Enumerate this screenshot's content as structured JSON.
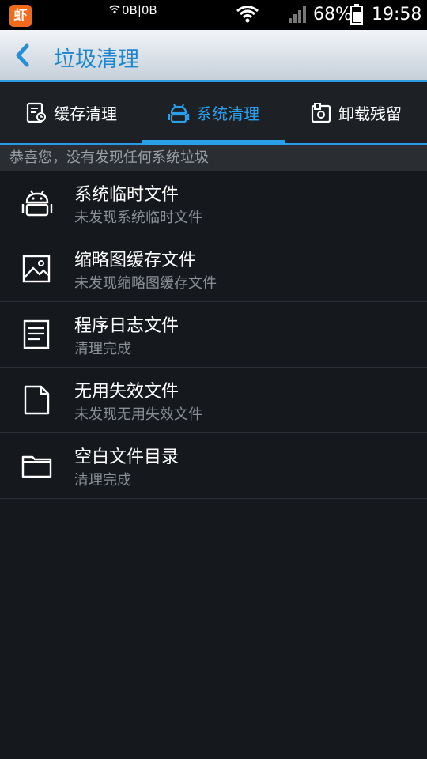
{
  "status_bar": {
    "app_icon_glyph": "虾",
    "net_speed": "0B|0B",
    "battery_percent": "68%",
    "time": "19:58"
  },
  "header": {
    "back_icon": "chevron-left-icon",
    "title": "垃圾清理"
  },
  "tabs": [
    {
      "label": "缓存清理",
      "icon": "cache-doc-icon",
      "active": false
    },
    {
      "label": "系统清理",
      "icon": "android-icon",
      "active": true
    },
    {
      "label": "卸载残留",
      "icon": "uninstall-residue-icon",
      "active": false
    }
  ],
  "banner": "恭喜您，没有发现任何系统垃圾",
  "items": [
    {
      "title": "系统临时文件",
      "subtitle": "未发现系统临时文件",
      "icon": "android-icon"
    },
    {
      "title": "缩略图缓存文件",
      "subtitle": "未发现缩略图缓存文件",
      "icon": "image-icon"
    },
    {
      "title": "程序日志文件",
      "subtitle": "清理完成",
      "icon": "log-file-icon"
    },
    {
      "title": "无用失效文件",
      "subtitle": "未发现无用失效文件",
      "icon": "file-icon"
    },
    {
      "title": "空白文件目录",
      "subtitle": "清理完成",
      "icon": "folder-icon"
    }
  ],
  "colors": {
    "accent": "#2aa0ea",
    "title_blue": "#1c86d3",
    "app_icon_bg": "#f26a1b"
  }
}
